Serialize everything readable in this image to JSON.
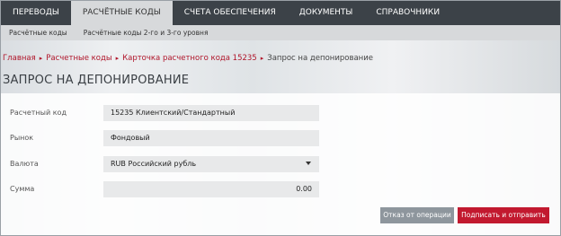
{
  "topnav": {
    "tabs": [
      {
        "label": "ПЕРЕВОДЫ"
      },
      {
        "label": "РАСЧЁТНЫЕ КОДЫ"
      },
      {
        "label": "СЧЕТА ОБЕСПЕЧЕНИЯ"
      },
      {
        "label": "ДОКУМЕНТЫ"
      },
      {
        "label": "СПРАВОЧНИКИ"
      }
    ],
    "active_index": 1
  },
  "subnav": {
    "items": [
      {
        "label": "Расчётные коды"
      },
      {
        "label": "Расчётные коды 2-го и 3-го уровня"
      }
    ]
  },
  "breadcrumb": {
    "items": [
      {
        "label": "Главная"
      },
      {
        "label": "Расчетные коды"
      },
      {
        "label": "Карточка расчетного кода 15235"
      }
    ],
    "current": "Запрос на депонирование"
  },
  "page_title": "ЗАПРОС НА ДЕПОНИРОВАНИЕ",
  "form": {
    "settlement_code": {
      "label": "Расчетный код",
      "value": "15235 Клиентский/Стандартный"
    },
    "market": {
      "label": "Рынок",
      "value": "Фондовый"
    },
    "currency": {
      "label": "Валюта",
      "value": "RUB Российский рубль"
    },
    "amount": {
      "label": "Сумма",
      "value": "0.00"
    }
  },
  "buttons": {
    "decline": "Отказ от операции",
    "sign_send": "Подписать и отправить"
  },
  "colors": {
    "nav_bg": "#3c4248",
    "accent_red": "#c2192f",
    "link_red": "#b0152a",
    "secondary_button": "#8e969d"
  }
}
